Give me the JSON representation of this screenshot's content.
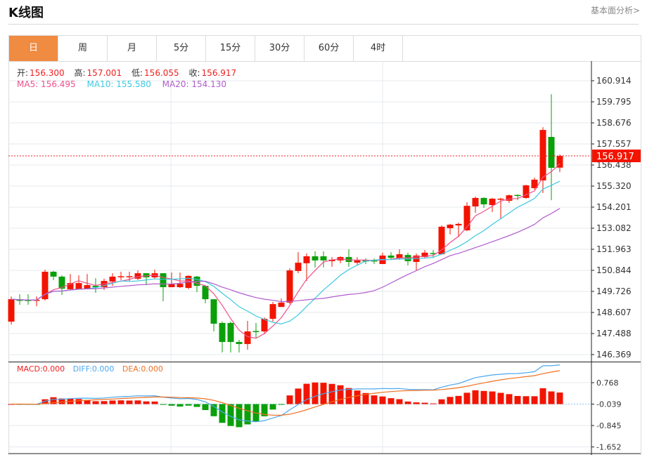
{
  "header": {
    "title": "K线图",
    "link": "基本面分析>"
  },
  "tabs": [
    {
      "label": "日",
      "active": true
    },
    {
      "label": "周"
    },
    {
      "label": "月"
    },
    {
      "label": "5分"
    },
    {
      "label": "15分"
    },
    {
      "label": "30分"
    },
    {
      "label": "60分"
    },
    {
      "label": "4时"
    }
  ],
  "info": {
    "open_label": "开:",
    "open": "156.300",
    "high_label": "高:",
    "high": "157.001",
    "low_label": "低:",
    "low": "156.055",
    "close_label": "收:",
    "close": "156.917",
    "ma5": "MA5: 156.495",
    "ma10": "MA10: 155.580",
    "ma20": "MA20: 154.130"
  },
  "macd_info": {
    "macd": "MACD:0.000",
    "diff": "DIFF:0.000",
    "dea": "DEA:0.000"
  },
  "colors": {
    "up": "#f21400",
    "down": "#0aa00a",
    "ma5": "#f0508a",
    "ma10": "#3cc8e0",
    "ma20": "#b05ccc",
    "diff": "#4aa8f0",
    "dea": "#f07020",
    "tab_active": "#f08b42"
  },
  "chart_data": [
    {
      "type": "candlestick",
      "title": "K线图",
      "price_ticks": [
        "160.914",
        "159.795",
        "158.676",
        "157.557",
        "156.438",
        "155.320",
        "154.201",
        "153.082",
        "151.963",
        "150.844",
        "149.726",
        "148.607",
        "147.488",
        "146.369"
      ],
      "ylim": [
        146.369,
        160.914
      ],
      "last_price": "156.917",
      "ohlc": [
        [
          148.12,
          149.46,
          147.97,
          149.31
        ],
        [
          149.28,
          149.57,
          149.01,
          149.25
        ],
        [
          149.27,
          149.57,
          149.01,
          149.25
        ],
        [
          149.25,
          149.46,
          148.94,
          149.28
        ],
        [
          149.31,
          150.88,
          149.24,
          150.77
        ],
        [
          150.77,
          150.81,
          150.32,
          150.51
        ],
        [
          150.51,
          150.58,
          149.54,
          149.87
        ],
        [
          149.84,
          150.65,
          149.8,
          150.17
        ],
        [
          149.84,
          150.58,
          149.84,
          150.17
        ],
        [
          149.84,
          150.65,
          149.84,
          150.06
        ],
        [
          150.02,
          150.43,
          149.65,
          149.95
        ],
        [
          149.95,
          150.4,
          149.8,
          150.28
        ],
        [
          150.25,
          150.69,
          150.02,
          150.51
        ],
        [
          150.51,
          150.77,
          150.32,
          150.53
        ],
        [
          150.51,
          150.77,
          150.28,
          150.53
        ],
        [
          150.4,
          150.84,
          150.32,
          150.69
        ],
        [
          150.69,
          150.69,
          150.06,
          150.47
        ],
        [
          150.47,
          150.88,
          150.4,
          150.69
        ],
        [
          150.69,
          150.69,
          149.2,
          149.95
        ],
        [
          149.95,
          150.73,
          149.95,
          150.13
        ],
        [
          149.95,
          150.73,
          149.91,
          150.13
        ],
        [
          149.91,
          150.58,
          149.84,
          150.55
        ],
        [
          150.51,
          150.55,
          149.69,
          150.02
        ],
        [
          150.02,
          150.06,
          149.09,
          149.31
        ],
        [
          149.31,
          149.31,
          147.6,
          148.01
        ],
        [
          148.05,
          148.12,
          146.48,
          147.04
        ],
        [
          148.05,
          148.12,
          146.48,
          147.04
        ],
        [
          147.04,
          147.15,
          146.48,
          146.93
        ],
        [
          146.93,
          148.16,
          146.63,
          147.6
        ],
        [
          147.62,
          148.05,
          147.23,
          147.58
        ],
        [
          147.6,
          148.34,
          147.45,
          148.27
        ],
        [
          148.27,
          149.16,
          148.12,
          149.05
        ],
        [
          148.9,
          149.35,
          148.9,
          149.13
        ],
        [
          149.13,
          150.95,
          149.05,
          150.84
        ],
        [
          150.81,
          151.81,
          150.69,
          151.25
        ],
        [
          151.22,
          151.74,
          150.28,
          151.59
        ],
        [
          151.59,
          151.85,
          151.0,
          151.37
        ],
        [
          151.59,
          151.85,
          151.0,
          151.37
        ],
        [
          151.33,
          151.55,
          151.03,
          151.41
        ],
        [
          151.37,
          151.59,
          151.22,
          151.55
        ],
        [
          151.55,
          151.96,
          151.03,
          151.29
        ],
        [
          151.25,
          151.55,
          151.14,
          151.37
        ],
        [
          151.37,
          151.48,
          151.18,
          151.33
        ],
        [
          151.37,
          151.48,
          151.18,
          151.33
        ],
        [
          151.18,
          151.78,
          151.18,
          151.63
        ],
        [
          151.63,
          151.81,
          151.4,
          151.51
        ],
        [
          151.48,
          151.96,
          151.4,
          151.7
        ],
        [
          151.66,
          151.78,
          151.1,
          151.33
        ],
        [
          151.29,
          151.74,
          150.84,
          151.63
        ],
        [
          151.55,
          151.92,
          151.48,
          151.78
        ],
        [
          151.76,
          151.92,
          151.51,
          151.74
        ],
        [
          151.7,
          153.23,
          151.66,
          153.16
        ],
        [
          153.08,
          153.31,
          152.75,
          153.27
        ],
        [
          153.23,
          153.38,
          152.6,
          153.31
        ],
        [
          152.97,
          154.46,
          152.93,
          154.27
        ],
        [
          154.24,
          154.76,
          153.9,
          154.69
        ],
        [
          154.69,
          154.72,
          154.16,
          154.35
        ],
        [
          154.31,
          154.69,
          153.94,
          154.65
        ],
        [
          154.61,
          154.69,
          153.6,
          154.65
        ],
        [
          154.54,
          154.87,
          154.42,
          154.83
        ],
        [
          154.85,
          154.87,
          154.57,
          154.81
        ],
        [
          154.69,
          155.39,
          154.65,
          155.36
        ],
        [
          155.21,
          155.77,
          155.13,
          155.66
        ],
        [
          155.62,
          158.45,
          154.95,
          158.3
        ],
        [
          157.93,
          160.2,
          154.57,
          156.29
        ],
        [
          156.3,
          157.001,
          156.055,
          156.917
        ]
      ]
    },
    {
      "type": "macd",
      "ticks": [
        "0.768",
        "-0.039",
        "-0.845",
        "-1.652"
      ],
      "ylim": [
        -1.652,
        0.768
      ],
      "params": [
        12,
        26,
        9
      ]
    }
  ]
}
